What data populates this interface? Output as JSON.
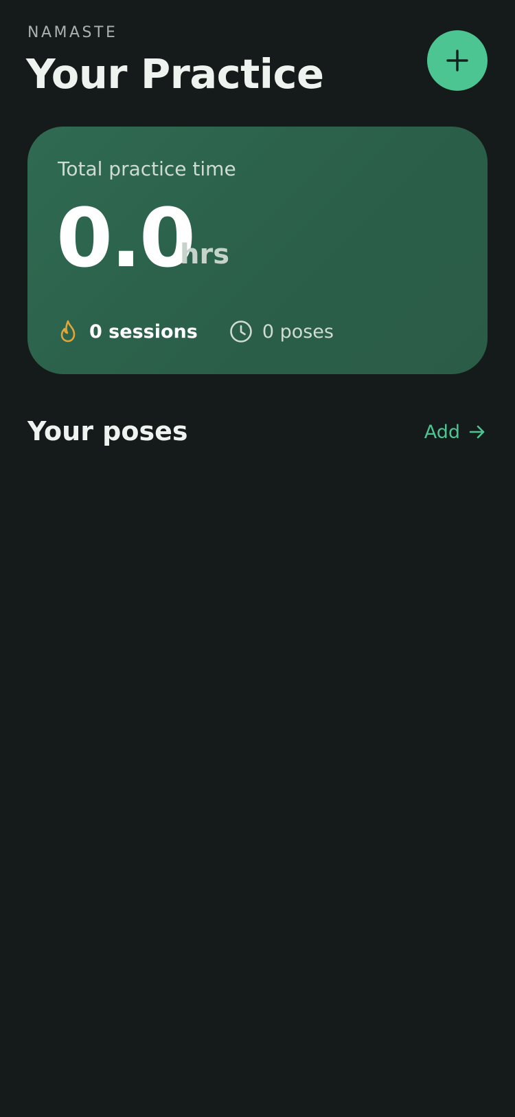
{
  "header": {
    "greeting": "NAMASTE",
    "title": "Your Practice",
    "add_button_icon": "plus-icon"
  },
  "stats": {
    "label": "Total practice time",
    "total_hours": "0.0",
    "unit": "hrs",
    "sessions_text": "0 sessions",
    "sessions_icon": "flame-icon",
    "poses_text": "0 poses",
    "poses_icon": "clock-icon"
  },
  "poses_section": {
    "title": "Your poses",
    "add_label": "Add",
    "add_icon": "arrow-right-icon",
    "items": []
  },
  "colors": {
    "background": "#151b1a",
    "accent": "#4cc592",
    "card": "#2f6a52",
    "flame": "#e0a63a"
  }
}
